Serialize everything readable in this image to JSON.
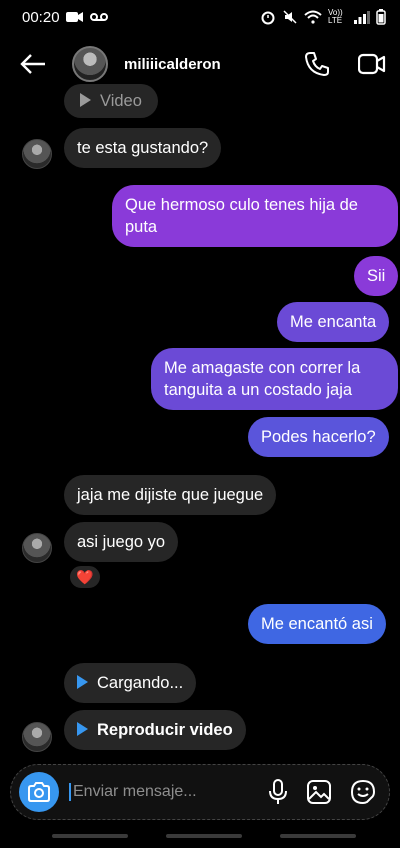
{
  "status": {
    "time": "00:20",
    "network": "Vo)) LTE"
  },
  "header": {
    "username": "miliiicalderon"
  },
  "messages": {
    "video_top": "Video",
    "m1": "te esta gustando?",
    "m2_line1": "Que hermoso culo tenes hija de",
    "m2_line2": "puta",
    "m3": "Sii",
    "m4": "Me encanta",
    "m5_line1": "Me amagaste con correr la",
    "m5_line2": "tanguita a un costado jaja",
    "m6": "Podes hacerlo?",
    "m7": "jaja me dijiste que juegue",
    "m8": "asi juego yo",
    "reaction": "❤️",
    "m9": "Me encantó asi",
    "m10": "Cargando...",
    "m11": "Reproducir video"
  },
  "composer": {
    "placeholder": "Enviar mensaje..."
  },
  "icons": [
    "back-arrow-icon",
    "phone-icon",
    "video-call-icon",
    "camera-icon",
    "microphone-icon",
    "gallery-icon",
    "sticker-icon",
    "play-icon"
  ],
  "colors": {
    "them": "#262626",
    "me_purple": "#8a3ad9",
    "me_blue": "#3f67e3",
    "accent": "#3797f0"
  }
}
